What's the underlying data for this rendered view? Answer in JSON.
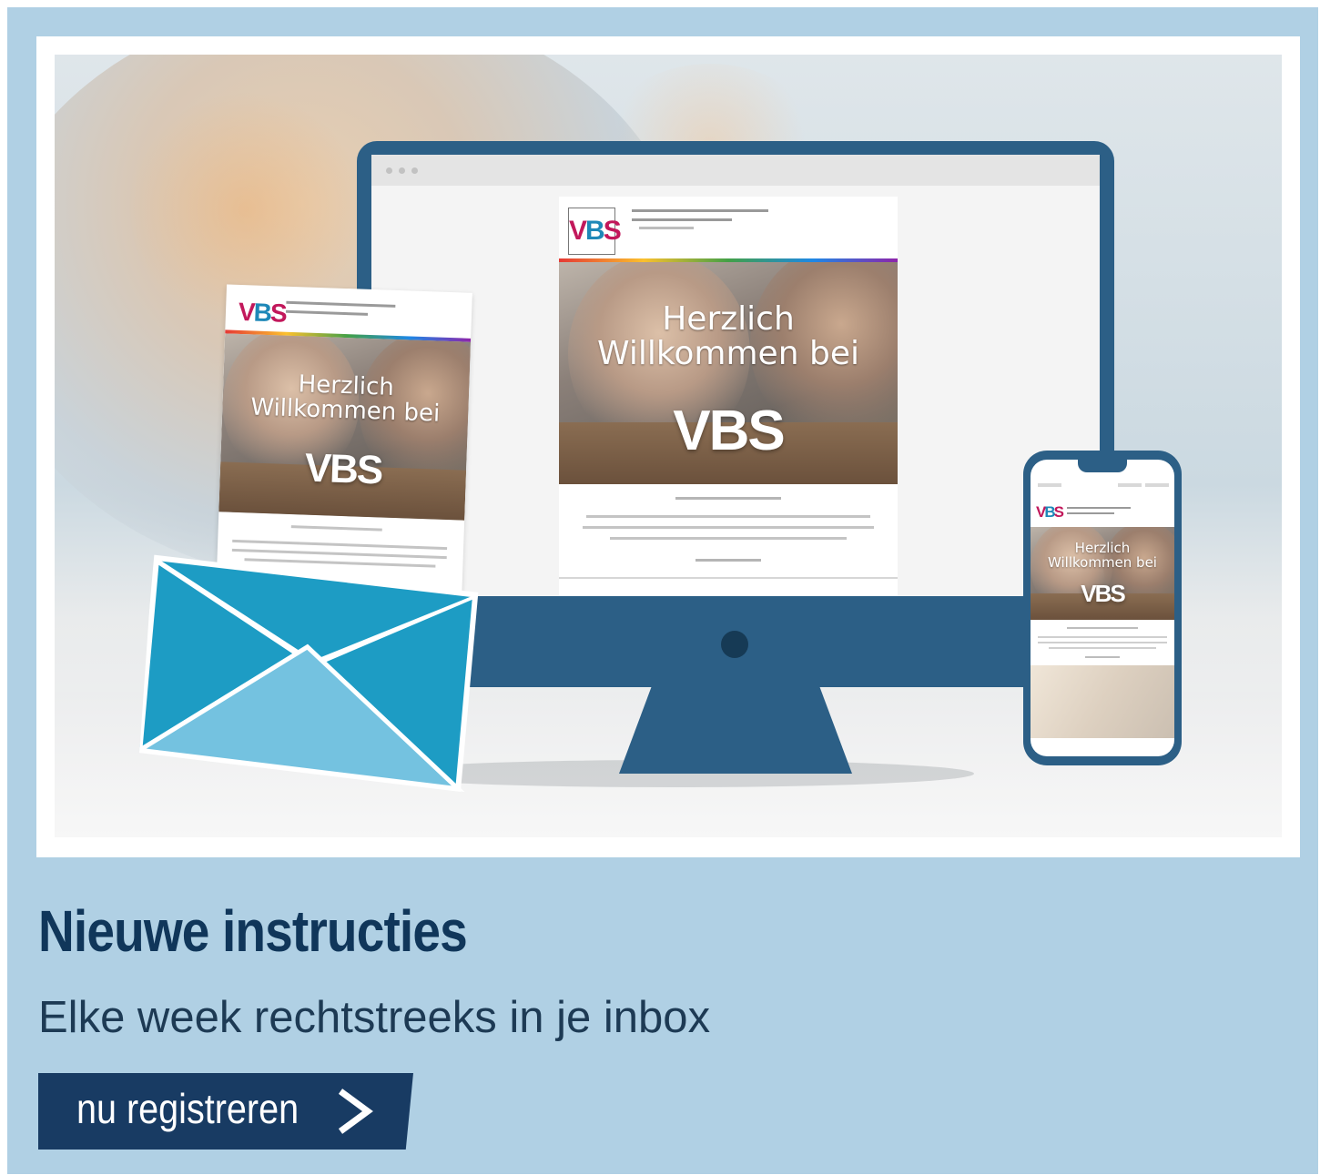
{
  "banner": {
    "title": "Nieuwe instructies",
    "subtitle": "Elke week rechtstreeks in je inbox",
    "cta": {
      "label": "nu registreren",
      "icon": "chevron-right-icon"
    }
  },
  "illustration": {
    "logo_text": "VBS",
    "hero_line1": "Herzlich",
    "hero_line2": "Willkommen bei",
    "colors": {
      "device": "#2c5f86",
      "envelope_dark": "#1d9cc4",
      "envelope_light": "#74c2e0",
      "brand_pink": "#c2185b",
      "brand_blue": "#1e88b8"
    }
  }
}
